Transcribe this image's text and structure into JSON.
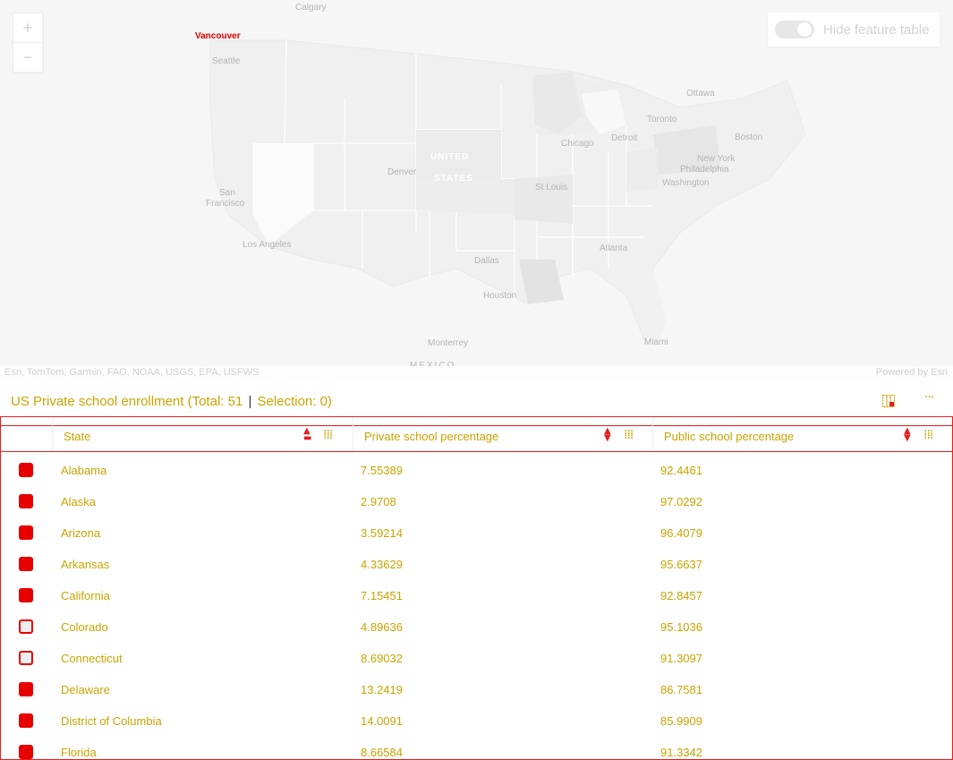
{
  "map": {
    "zoom_in": "+",
    "zoom_out": "−",
    "toggle_label": "Hide feature table",
    "attribution_left": "Esri, TomTom, Garmin, FAO, NOAA, USGS, EPA, USFWS",
    "attribution_right": "Powered by Esri",
    "labels": {
      "calgary": "Calgary",
      "vancouver": "Vancouver",
      "seattle": "Seattle",
      "ottawa": "Ottawa",
      "toronto": "Toronto",
      "chicago": "Chicago",
      "detroit": "Detroit",
      "boston": "Boston",
      "new_york": "New York",
      "philadelphia": "Philadelphia",
      "washington": "Washington",
      "denver": "Denver",
      "united": "UNITED",
      "states": "STATES",
      "st_louis": "St Louis",
      "san_francisco_1": "San",
      "san_francisco_2": "Francisco",
      "los_angeles": "Los Angeles",
      "dallas": "Dallas",
      "atlanta": "Atlanta",
      "houston": "Houston",
      "monterrey": "Monterrey",
      "miami": "Miami",
      "mexico": "MEXICO"
    },
    "colors": {
      "highlight": "#e00000",
      "land": "#f3f3f3",
      "water": "#f7f7f7"
    }
  },
  "table": {
    "title": {
      "name": "US Private school enrollment",
      "total": "(Total: 51",
      "selection": "Selection: 0)"
    },
    "icons": {
      "column_chooser": "column-chooser-icon",
      "more": "more-options-icon"
    },
    "columns": [
      {
        "label": "State"
      },
      {
        "label": "Private school percentage"
      },
      {
        "label": "Public school percentage"
      }
    ],
    "rows": [
      {
        "checked": true,
        "state": "Alabama",
        "private": "7.55389",
        "public": "92.4461"
      },
      {
        "checked": true,
        "state": "Alaska",
        "private": "2.9708",
        "public": "97.0292"
      },
      {
        "checked": true,
        "state": "Arizona",
        "private": "3.59214",
        "public": "96.4079"
      },
      {
        "checked": true,
        "state": "Arkansas",
        "private": "4.33629",
        "public": "95.6637"
      },
      {
        "checked": true,
        "state": "California",
        "private": "7.15451",
        "public": "92.8457"
      },
      {
        "checked": false,
        "state": "Colorado",
        "private": "4.89636",
        "public": "95.1036"
      },
      {
        "checked": false,
        "state": "Connecticut",
        "private": "8.69032",
        "public": "91.3097"
      },
      {
        "checked": true,
        "state": "Delaware",
        "private": "13.2419",
        "public": "86.7581"
      },
      {
        "checked": true,
        "state": "District of Columbia",
        "private": "14.0091",
        "public": "85.9909"
      },
      {
        "checked": true,
        "state": "Florida",
        "private": "8.66584",
        "public": "91.3342"
      }
    ],
    "colors": {
      "accent": "#e02020",
      "text": "#c8a400"
    }
  }
}
